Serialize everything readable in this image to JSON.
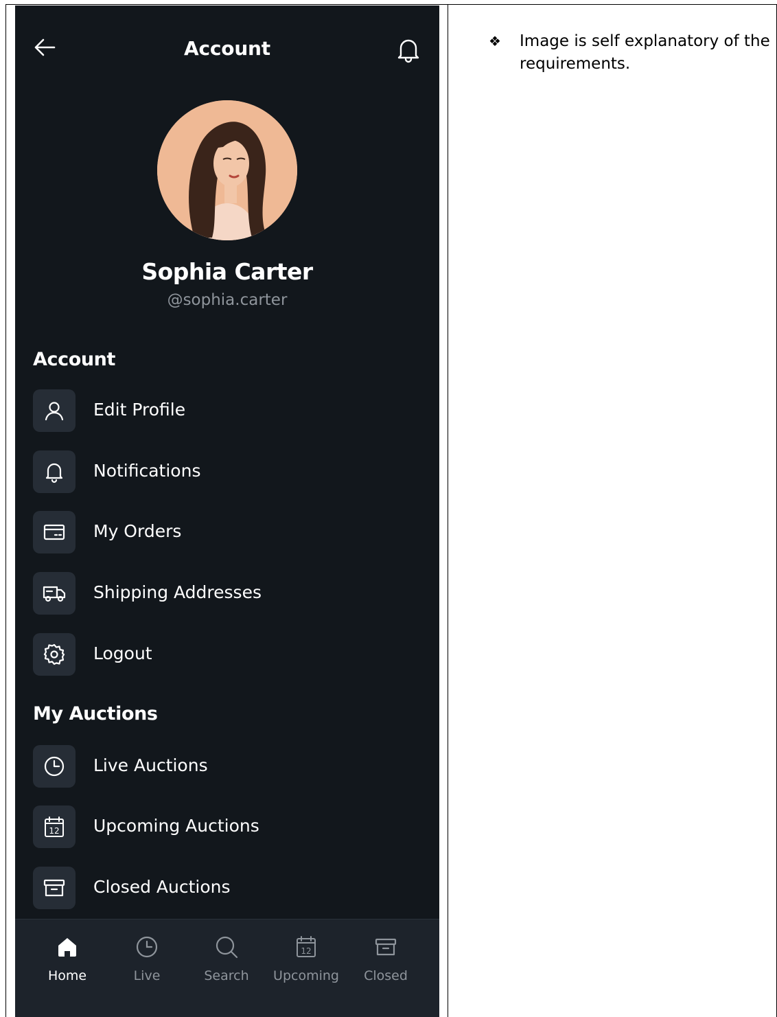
{
  "header": {
    "title": "Account"
  },
  "profile": {
    "name": "Sophia Carter",
    "handle": "@sophia.carter"
  },
  "sections": {
    "account": {
      "title": "Account",
      "items": [
        {
          "label": "Edit Profile",
          "icon": "user-icon"
        },
        {
          "label": "Notifications",
          "icon": "bell-icon"
        },
        {
          "label": "My Orders",
          "icon": "card-icon"
        },
        {
          "label": "Shipping Addresses",
          "icon": "truck-icon"
        },
        {
          "label": "Logout",
          "icon": "gear-icon"
        }
      ]
    },
    "auctions": {
      "title": "My Auctions",
      "items": [
        {
          "label": "Live Auctions",
          "icon": "clock-icon"
        },
        {
          "label": "Upcoming Auctions",
          "icon": "calendar-icon"
        },
        {
          "label": "Closed Auctions",
          "icon": "archive-icon"
        }
      ]
    }
  },
  "bottom_nav": {
    "active": "Home",
    "items": [
      {
        "label": "Home",
        "icon": "home-icon"
      },
      {
        "label": "Live",
        "icon": "clock-icon"
      },
      {
        "label": "Search",
        "icon": "search-icon"
      },
      {
        "label": "Upcoming",
        "icon": "calendar-icon"
      },
      {
        "label": "Closed",
        "icon": "archive-icon"
      }
    ]
  },
  "calendar_day": "12",
  "note": {
    "bullet": "❖",
    "text": "Image is self explanatory of the requirements."
  },
  "colors": {
    "background": "#12171c",
    "tile": "#262d36",
    "nav_background": "#1d232b",
    "muted_text": "#8f959c",
    "avatar_background": "#efb995"
  }
}
